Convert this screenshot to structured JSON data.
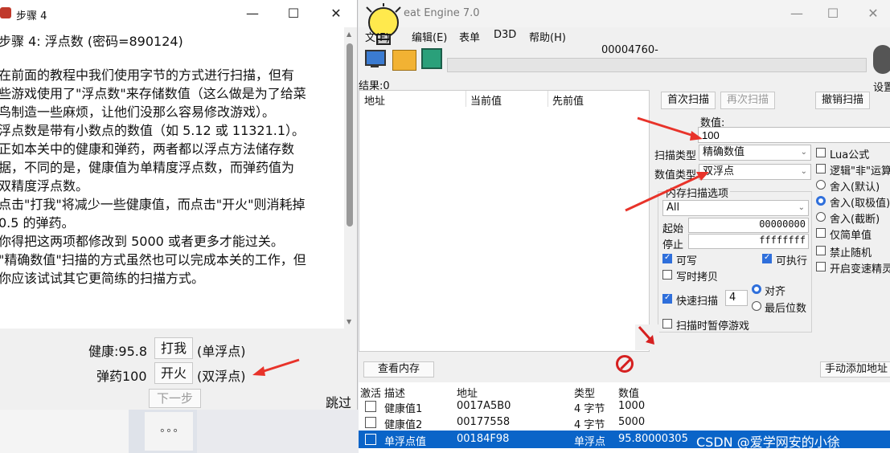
{
  "tutorial": {
    "title": "步骤 4",
    "heading": "步骤 4: 浮点数 (密码=890124)",
    "paragraphs": [
      "在前面的教程中我们使用字节的方式进行扫描，但有",
      "些游戏使用了\"浮点数\"来存储数值（这么做是为了给菜",
      "鸟制造一些麻烦，让他们没那么容易修改游戏）。",
      "浮点数是带有小数点的数值（如 5.12 或 11321.1）。",
      "正如本关中的健康和弹药，两者都以浮点方法储存数",
      "据，不同的是，健康值为单精度浮点数，而弹药值为",
      "双精度浮点数。",
      "点击\"打我\"将减少一些健康值，而点击\"开火\"则消耗掉",
      "0.5 的弹药。",
      "你得把这两项都修改到 5000 或者更多才能过关。",
      "\"精确数值\"扫描的方式虽然也可以完成本关的工作，但",
      "你应该试试其它更简练的扫描方式。"
    ],
    "health_label": "健康:95.8",
    "hit_button": "打我",
    "health_type": "(单浮点)",
    "ammo_label": "弹药100",
    "fire_button": "开火",
    "ammo_type": "(双浮点)",
    "next_button": "下一步",
    "skip_label": "跳过"
  },
  "ce": {
    "title": "Cheat Engine 7.0",
    "title_visible": "eat Engine 7.0",
    "menu": [
      "文件(F)",
      "编辑(E)",
      "表单",
      "D3D",
      "帮助(H)"
    ],
    "menu_visible_first": "文(F)",
    "process": "00004760-",
    "settings_label": "设置",
    "results_label": "结果:0",
    "columns": [
      "地址",
      "当前值",
      "先前值"
    ],
    "first_scan": "首次扫描",
    "next_scan": "再次扫描",
    "undo_scan": "撤销扫描",
    "value_label": "数值:",
    "value": "100",
    "scan_type_label": "扫描类型",
    "scan_type": "精确数值",
    "value_type_label": "数值类型",
    "value_type": "双浮点",
    "mem_options": "内存扫描选项",
    "mem_region": "All",
    "start_label": "起始",
    "start_value": "00000000",
    "stop_label": "停止",
    "stop_value": "ffffffff",
    "writable": "可写",
    "executable": "可执行",
    "copy_on_write": "写时拷贝",
    "fast_scan": "快速扫描",
    "fast_scan_value": "4",
    "align": "对齐",
    "last_digits": "最后位数",
    "pause_game": "扫描时暂停游戏",
    "right_options": [
      "Lua公式",
      "逻辑\"非\"运算",
      "舍入(默认)",
      "舍入(取极值)",
      "舍入(截断)",
      "仅简单值",
      "禁止随机",
      "开启变速精灵"
    ],
    "view_memory": "查看内存",
    "add_manual": "手动添加地址",
    "table_headers": [
      "激活",
      "描述",
      "地址",
      "类型",
      "数值"
    ],
    "table_rows": [
      {
        "desc": "健康值1",
        "addr": "0017A5B0",
        "type": "4 字节",
        "value": "1000"
      },
      {
        "desc": "健康值2",
        "addr": "00177558",
        "type": "4 字节",
        "value": "5000"
      },
      {
        "desc": "单浮点值",
        "addr": "00184F98",
        "type": "单浮点",
        "value": "95.80000305"
      }
    ],
    "watermark": "CSDN @爱学网安的小徐"
  },
  "colors": {
    "accent": "#2f6fdb",
    "arrow": "#e8332a",
    "selected_row": "#0a64c8"
  }
}
